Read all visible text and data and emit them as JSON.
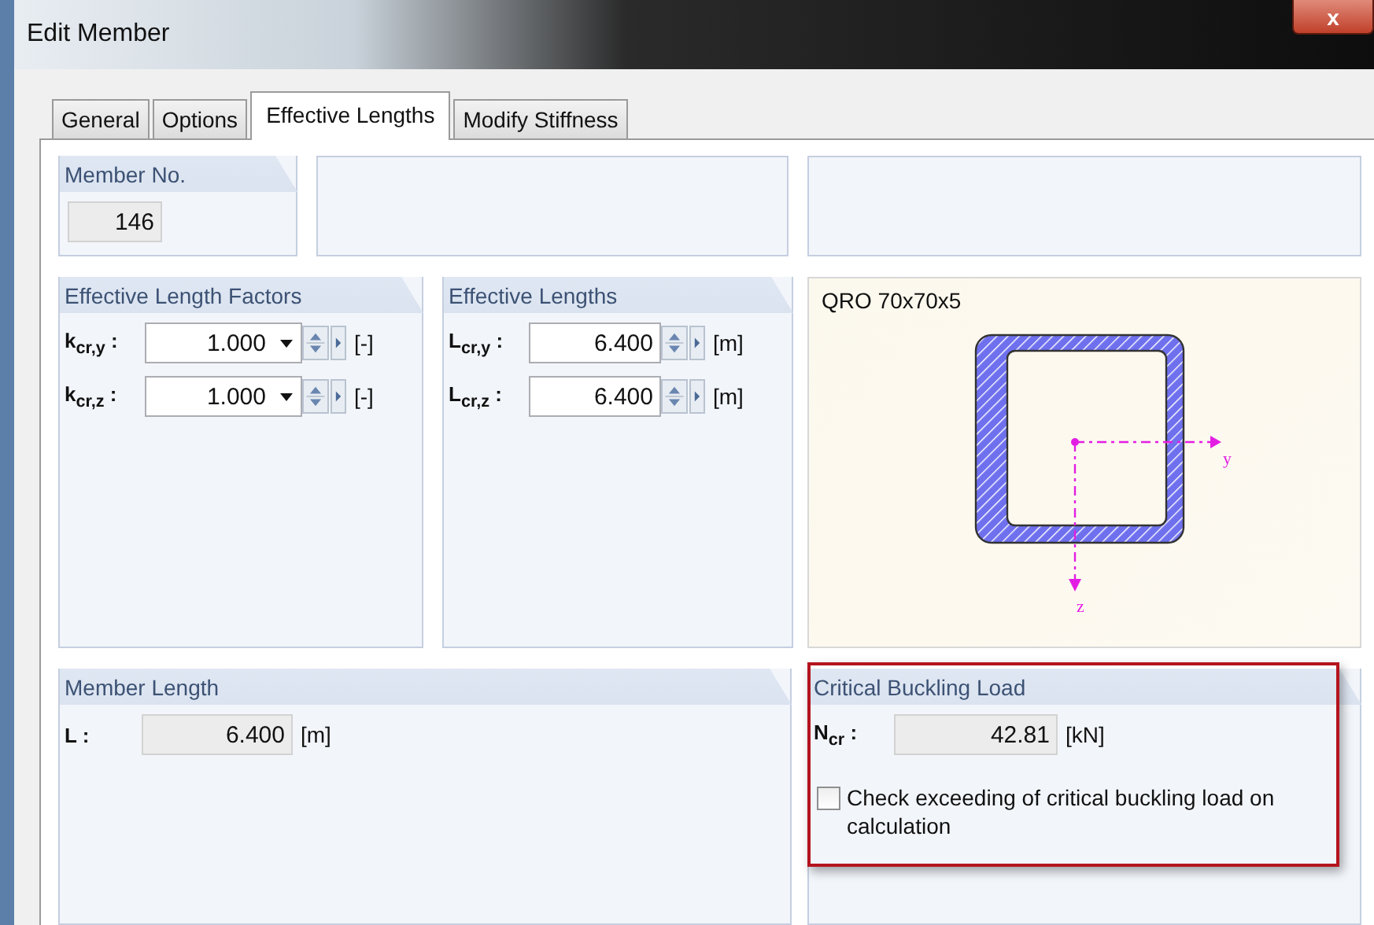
{
  "window": {
    "title": "Edit Member",
    "close": "x"
  },
  "tabs": [
    {
      "label": "General",
      "selected": false
    },
    {
      "label": "Options",
      "selected": false
    },
    {
      "label": "Effective Lengths",
      "selected": true
    },
    {
      "label": "Modify Stiffness",
      "selected": false
    }
  ],
  "member_no": {
    "title": "Member No.",
    "value": "146",
    "disabled": true
  },
  "factors": {
    "title": "Effective Length Factors",
    "rows": [
      {
        "label": "k$_{cr,y}$ :",
        "value": "1.000",
        "unit": "[-]",
        "dropdown": true
      },
      {
        "label": "k$_{cr,z}$ :",
        "value": "1.000",
        "unit": "[-]",
        "dropdown": true
      }
    ]
  },
  "lengths": {
    "title": "Effective Lengths",
    "rows": [
      {
        "label": "L$_{cr,y}$ :",
        "value": "6.400",
        "unit": "[m]",
        "dropdown": false
      },
      {
        "label": "L$_{cr,z}$ :",
        "value": "6.400",
        "unit": "[m]",
        "dropdown": false
      }
    ]
  },
  "section": {
    "title": "QRO 70x70x5",
    "axis_y": "y",
    "axis_z": "z"
  },
  "member_length": {
    "title": "Member Length",
    "label": "L :",
    "value": "6.400",
    "unit": "[m]",
    "disabled": true
  },
  "critical": {
    "title": "Critical Buckling Load",
    "label": "N$_{cr}$ :",
    "value": "42.81",
    "unit": "[kN]",
    "disabled": true,
    "highlighted": true,
    "checkbox": {
      "label": "Check exceeding of critical buckling load on calculation",
      "checked": false
    }
  }
}
